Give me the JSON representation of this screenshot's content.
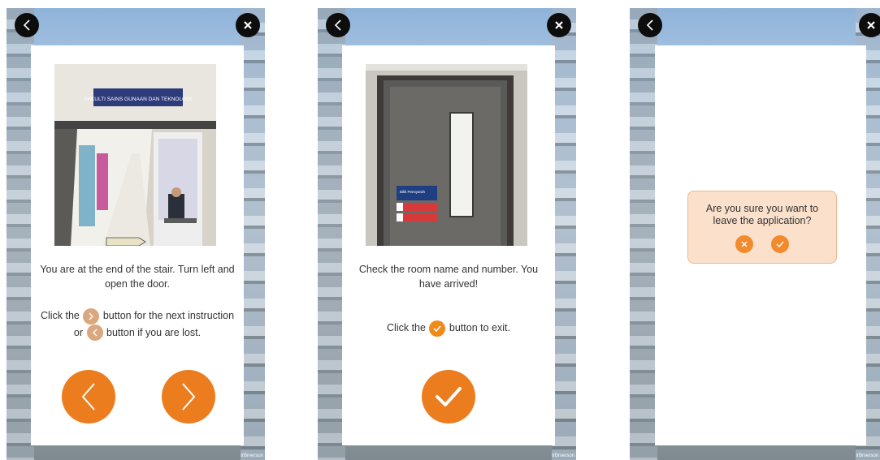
{
  "screens": {
    "screen1": {
      "instruction": "You are at the end of the stair. Turn left and open the door.",
      "help_part1": "Click the",
      "help_part2": "button for the next instruction or",
      "help_part3": "button if you are lost.",
      "photo_sign": "FAKULTI SAINS GUNAAN DAN TEKNOLOGI",
      "watermark": "trBrverson"
    },
    "screen2": {
      "instruction": "Check the room name and number. You have arrived!",
      "help_part1": "Click the",
      "help_part2": "button to exit.",
      "door_sign": "Bilik Pensyarah",
      "watermark": "trBrverson"
    },
    "screen3": {
      "dialog_message": "Are you sure you want to leave the application?",
      "watermark": "trBrverson"
    }
  },
  "colors": {
    "accent": "#ec7d1e",
    "pale_accent": "#dba77e",
    "dialog_bg": "#fbe1cc"
  },
  "icons": {
    "back": "chevron-left-icon",
    "close": "close-icon",
    "next": "chevron-right-icon",
    "confirm": "check-icon",
    "cancel": "x-icon"
  }
}
